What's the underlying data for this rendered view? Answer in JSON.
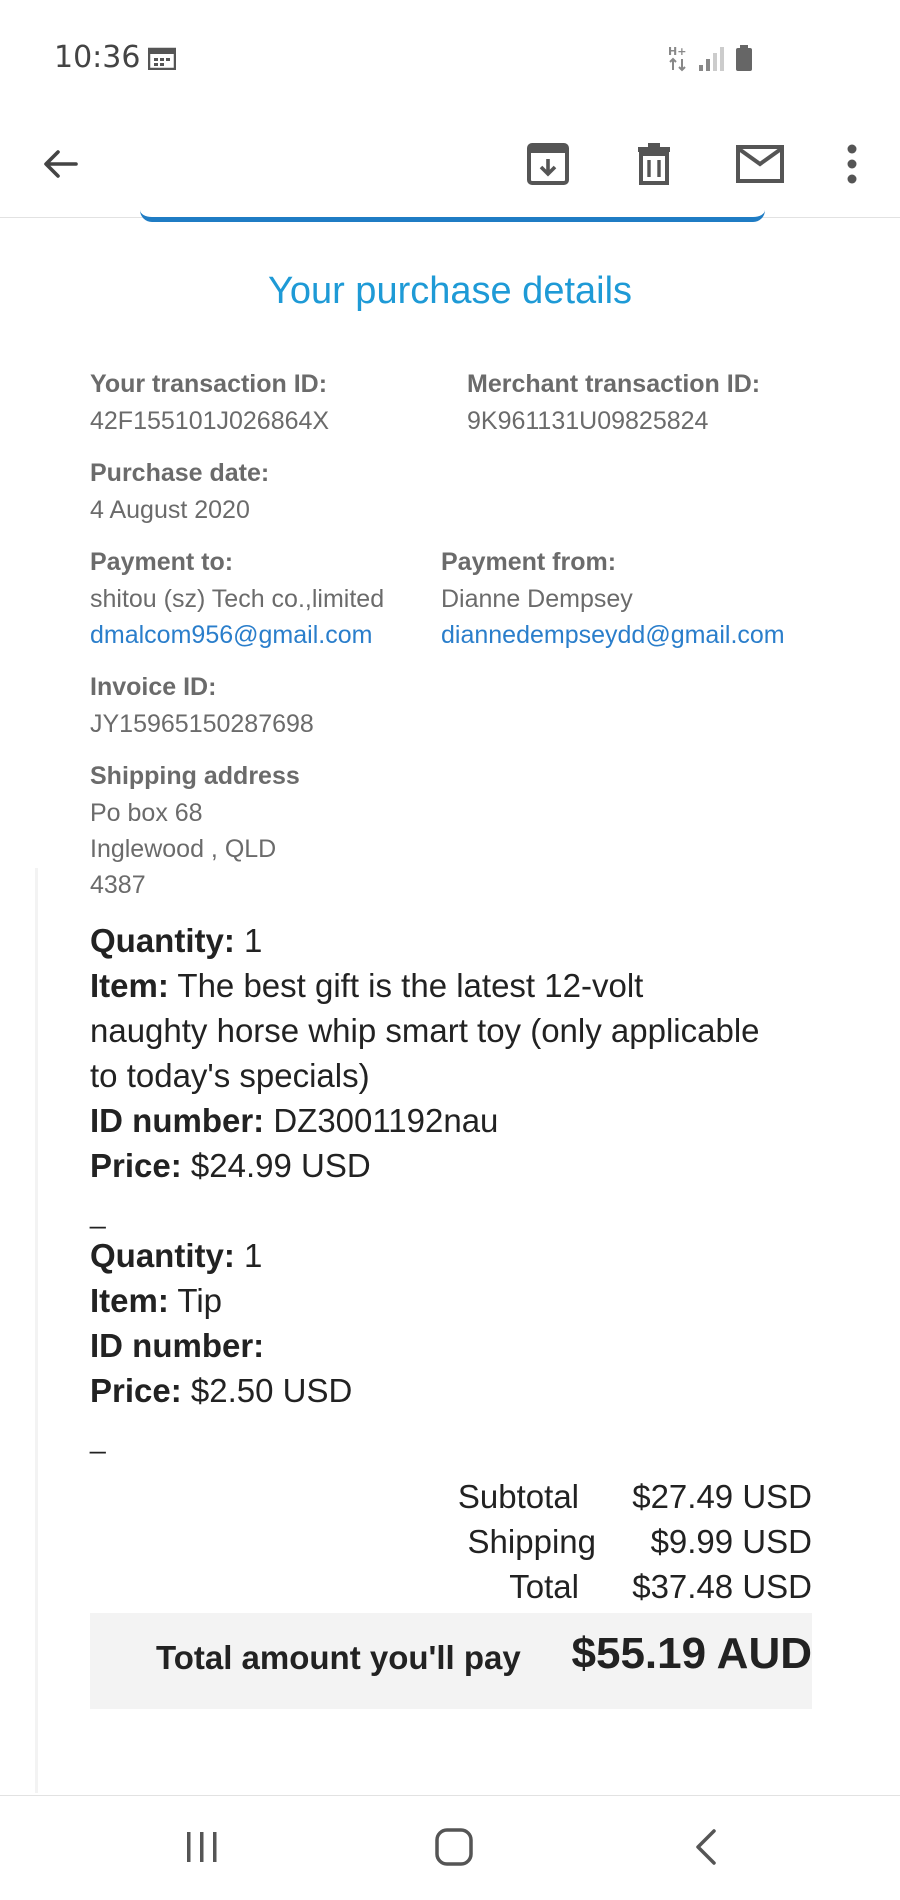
{
  "status_bar": {
    "time": "10:36",
    "icons": [
      "calendar-icon",
      "network-hplus-icon",
      "signal-icon",
      "battery-icon"
    ]
  },
  "toolbar": {
    "icons": [
      "back-arrow-icon",
      "archive-icon",
      "trash-icon",
      "mail-icon",
      "more-vert-icon"
    ]
  },
  "purchase": {
    "title": "Your purchase details",
    "transaction_id_label": "Your transaction ID:",
    "transaction_id": "42F155101J026864X",
    "merchant_id_label": "Merchant transaction ID:",
    "merchant_id": "9K961131U09825824",
    "purchase_date_label": "Purchase date:",
    "purchase_date": "4 August 2020",
    "payment_to_label": "Payment to:",
    "payment_to_name": "shitou (sz) Tech co.,limited",
    "payment_to_email": "dmalcom956@gmail.com",
    "payment_from_label": "Payment from:",
    "payment_from_name": "Dianne Dempsey",
    "payment_from_email": "diannedempseydd@gmail.com",
    "invoice_id_label": "Invoice ID:",
    "invoice_id": "JY15965150287698",
    "shipping_address_label": "Shipping address",
    "shipping_address_lines": [
      "Po box 68",
      "Inglewood , QLD",
      "4387"
    ]
  },
  "items": [
    {
      "quantity_label": "Quantity:",
      "quantity": "1",
      "item_label": "Item:",
      "item_lines": [
        "The best gift is the latest 12-volt",
        "naughty horse whip smart toy (only applicable",
        "to today's specials)"
      ],
      "id_label": "ID number:",
      "id_number": "DZ3001192nau",
      "price_label": "Price:",
      "price": "$24.99 USD",
      "separator": "_"
    },
    {
      "quantity_label": "Quantity:",
      "quantity": "1",
      "item_label": "Item:",
      "item_lines": [
        "Tip"
      ],
      "id_label": "ID number:",
      "id_number": "",
      "price_label": "Price:",
      "price": "$2.50 USD",
      "separator": "_"
    }
  ],
  "summary": {
    "subtotal_label": "Subtotal",
    "subtotal": "$27.49 USD",
    "shipping_label": "Shipping",
    "shipping": "$9.99 USD",
    "total_label": "Total",
    "total": "$37.48 USD",
    "pay_label": "Total amount you'll pay",
    "pay_amount": "$55.19 AUD"
  },
  "colors": {
    "title_blue": "#1e9ad6",
    "link_blue": "#2a7ecb",
    "label_gray": "#6b6b6b",
    "total_bg": "#f3f3f3"
  },
  "nav": {
    "icons": [
      "recents-icon",
      "home-icon",
      "nav-back-icon"
    ]
  }
}
